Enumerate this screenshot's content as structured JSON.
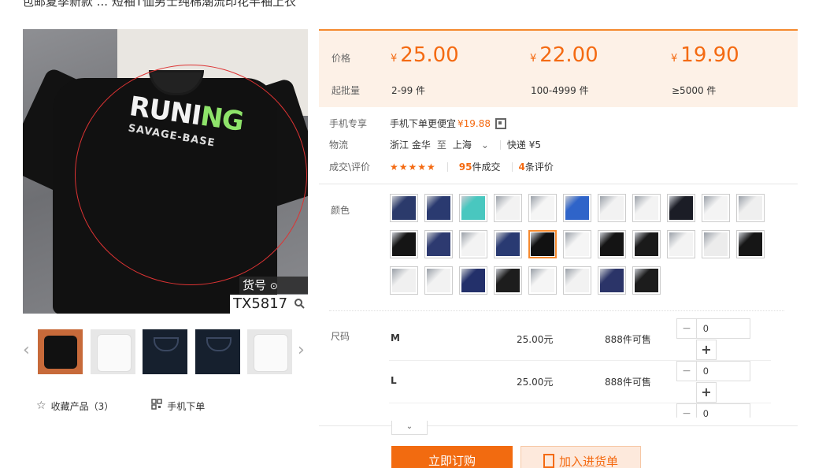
{
  "page": {
    "title_fragment": "包邮夏季新款  ...  短袖T恤男士纯棉潮流印花半袖上衣"
  },
  "gallery": {
    "sku_label": "货号",
    "sku_code": "TX5817",
    "print_text_white": "RUNI",
    "print_text_green": "NG",
    "print_sub": "SAVAGE-BASE",
    "prev_arrow": "‹",
    "next_arrow": "›",
    "thumbnails": [
      "thumb-1",
      "thumb-2",
      "thumb-3",
      "thumb-4",
      "thumb-5"
    ]
  },
  "links": {
    "favorite": "收藏产品（3）",
    "mobile_order": "手机下单"
  },
  "price_box": {
    "price_label": "价格",
    "moq_label": "起批量",
    "currency": "¥",
    "tiers": [
      {
        "price": "25.00",
        "qty": "2-99 件"
      },
      {
        "price": "22.00",
        "qty": "100-4999 件"
      },
      {
        "price": "19.90",
        "qty": "≥5000 件"
      }
    ]
  },
  "mobile_promo": {
    "label": "手机专享",
    "text": "手机下单更便宜",
    "price": "¥19.88"
  },
  "logistics": {
    "label": "物流",
    "from": "浙江 金华",
    "to_word": "至",
    "to": "上海",
    "express": "快递 ¥5"
  },
  "deals": {
    "label": "成交\\评价",
    "stars": "★★★★★",
    "deals_count": "95",
    "deals_text": "件成交",
    "reviews_count": "4",
    "reviews_text": "条评价"
  },
  "colors": {
    "label": "颜色",
    "swatches": [
      "#2b3a6b",
      "#2a3a70",
      "#49c7bf",
      "#f2f2f2",
      "#f5f5f5",
      "#2f64c9",
      "#f2f2f2",
      "#f3f3f3",
      "#1b1d26",
      "#f4f4f4",
      "#efefef",
      "#151515",
      "#2d3a70",
      "#f3f3f3",
      "#293a72",
      "#111111",
      "#f5f5f5",
      "#141414",
      "#1a1a1a",
      "#f3f3f3",
      "#ececec",
      "#161616",
      "#f0f0f0",
      "#f2f2f2",
      "#23306a",
      "#1d1d1d",
      "#f5f5f5",
      "#f2f2f2",
      "#2b3468",
      "#1c1c1c"
    ],
    "selected_index": 15
  },
  "sizes": {
    "label": "尺码",
    "rows": [
      {
        "name": "M",
        "price": "25.00元",
        "stock": "888件可售",
        "qty": "0"
      },
      {
        "name": "L",
        "price": "25.00元",
        "stock": "888件可售",
        "qty": "0"
      },
      {
        "name": "",
        "price": "",
        "stock": "",
        "qty": "0"
      }
    ]
  },
  "buttons": {
    "buy_now": "立即订购",
    "add_cart": "加入进货单",
    "expand": "⌄",
    "minus": "−",
    "plus": "+"
  }
}
